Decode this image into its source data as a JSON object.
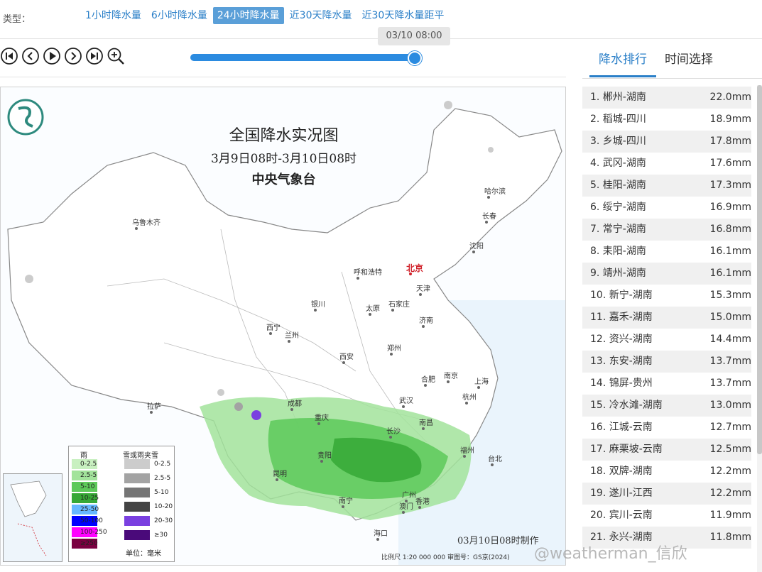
{
  "type_label": "类型：",
  "tabs": [
    {
      "label": "1小时降水量",
      "active": false
    },
    {
      "label": "6小时降水量",
      "active": false
    },
    {
      "label": "24小时降水量",
      "active": true
    },
    {
      "label": "近30天降水量",
      "active": false
    },
    {
      "label": "近30天降水量距平",
      "active": false
    }
  ],
  "time_tooltip": "03/10 08:00",
  "slider_progress": 1.0,
  "controls": [
    "skip-start-icon",
    "prev-icon",
    "play-icon",
    "next-icon",
    "skip-end-icon",
    "zoom-in-icon"
  ],
  "panel": {
    "tabs": [
      "降水排行",
      "时间选择"
    ],
    "active_tab": 0,
    "ranking": [
      {
        "name": "1. 郴州-湖南",
        "value": "22.0mm"
      },
      {
        "name": "2. 稻城-四川",
        "value": "18.9mm"
      },
      {
        "name": "3. 乡城-四川",
        "value": "17.8mm"
      },
      {
        "name": "4. 武冈-湖南",
        "value": "17.6mm"
      },
      {
        "name": "5. 桂阳-湖南",
        "value": "17.3mm"
      },
      {
        "name": "6. 绥宁-湖南",
        "value": "16.9mm"
      },
      {
        "name": "7. 常宁-湖南",
        "value": "16.8mm"
      },
      {
        "name": "8. 耒阳-湖南",
        "value": "16.1mm"
      },
      {
        "name": "9. 靖州-湖南",
        "value": "16.1mm"
      },
      {
        "name": "10. 新宁-湖南",
        "value": "15.3mm"
      },
      {
        "name": "11. 嘉禾-湖南",
        "value": "15.0mm"
      },
      {
        "name": "12. 资兴-湖南",
        "value": "14.4mm"
      },
      {
        "name": "13. 东安-湖南",
        "value": "13.7mm"
      },
      {
        "name": "14. 锦屏-贵州",
        "value": "13.7mm"
      },
      {
        "name": "15. 冷水滩-湖南",
        "value": "13.0mm"
      },
      {
        "name": "16. 江城-云南",
        "value": "12.7mm"
      },
      {
        "name": "17. 麻栗坡-云南",
        "value": "12.5mm"
      },
      {
        "name": "18. 双牌-湖南",
        "value": "12.2mm"
      },
      {
        "name": "19. 遂川-江西",
        "value": "12.2mm"
      },
      {
        "name": "20. 宾川-云南",
        "value": "11.9mm"
      },
      {
        "name": "21. 永兴-湖南",
        "value": "11.8mm"
      }
    ]
  },
  "map": {
    "title": "全国降水实况图",
    "subtitle": "3月9日08时-3月10日08时",
    "agency": "中央气象台",
    "made_time": "03月10日08时制作",
    "scale_text": "比例尺 1:20 000 000    审图号：GS京(2024)",
    "cities": [
      {
        "name": "乌鲁木齐",
        "type": "normal"
      },
      {
        "name": "哈尔滨",
        "type": "normal"
      },
      {
        "name": "长春",
        "type": "normal"
      },
      {
        "name": "沈阳",
        "type": "normal"
      },
      {
        "name": "北京",
        "type": "capital"
      },
      {
        "name": "天津",
        "type": "normal"
      },
      {
        "name": "呼和浩特",
        "type": "normal"
      },
      {
        "name": "银川",
        "type": "normal"
      },
      {
        "name": "太原",
        "type": "normal"
      },
      {
        "name": "石家庄",
        "type": "normal"
      },
      {
        "name": "济南",
        "type": "normal"
      },
      {
        "name": "西宁",
        "type": "normal"
      },
      {
        "name": "兰州",
        "type": "normal"
      },
      {
        "name": "西安",
        "type": "normal"
      },
      {
        "name": "郑州",
        "type": "normal"
      },
      {
        "name": "合肥",
        "type": "normal"
      },
      {
        "name": "南京",
        "type": "normal"
      },
      {
        "name": "上海",
        "type": "normal"
      },
      {
        "name": "杭州",
        "type": "normal"
      },
      {
        "name": "拉萨",
        "type": "normal"
      },
      {
        "name": "成都",
        "type": "normal"
      },
      {
        "name": "重庆",
        "type": "normal"
      },
      {
        "name": "武汉",
        "type": "normal"
      },
      {
        "name": "南昌",
        "type": "normal"
      },
      {
        "name": "长沙",
        "type": "normal"
      },
      {
        "name": "贵阳",
        "type": "normal"
      },
      {
        "name": "福州",
        "type": "normal"
      },
      {
        "name": "台北",
        "type": "normal"
      },
      {
        "name": "昆明",
        "type": "normal"
      },
      {
        "name": "南宁",
        "type": "normal"
      },
      {
        "name": "广州",
        "type": "normal"
      },
      {
        "name": "澳门",
        "type": "normal"
      },
      {
        "name": "香港",
        "type": "normal"
      },
      {
        "name": "海口",
        "type": "normal"
      }
    ],
    "legend": {
      "rain_header": "雨",
      "snow_header": "雪或雨夹雪",
      "unit": "单位：毫米",
      "rain": [
        {
          "label": "0-2.5",
          "color": "#c8f0c0"
        },
        {
          "label": "2.5-5",
          "color": "#a2e39b"
        },
        {
          "label": "5-10",
          "color": "#5dc95a"
        },
        {
          "label": "10-25",
          "color": "#36a836"
        },
        {
          "label": "25-50",
          "color": "#66b8ff"
        },
        {
          "label": "50-100",
          "color": "#0000ff"
        },
        {
          "label": "100-250",
          "color": "#ff00ff"
        },
        {
          "label": "≥250",
          "color": "#7a0040"
        }
      ],
      "snow": [
        {
          "label": "0-2.5",
          "color": "#cccccc"
        },
        {
          "label": "2.5-5",
          "color": "#a3a3a3"
        },
        {
          "label": "5-10",
          "color": "#757575"
        },
        {
          "label": "10-20",
          "color": "#444444"
        },
        {
          "label": "20-30",
          "color": "#7a40e0"
        },
        {
          "label": "≥30",
          "color": "#4a0a7a"
        }
      ]
    }
  },
  "watermark": "@weatherman_信欣"
}
